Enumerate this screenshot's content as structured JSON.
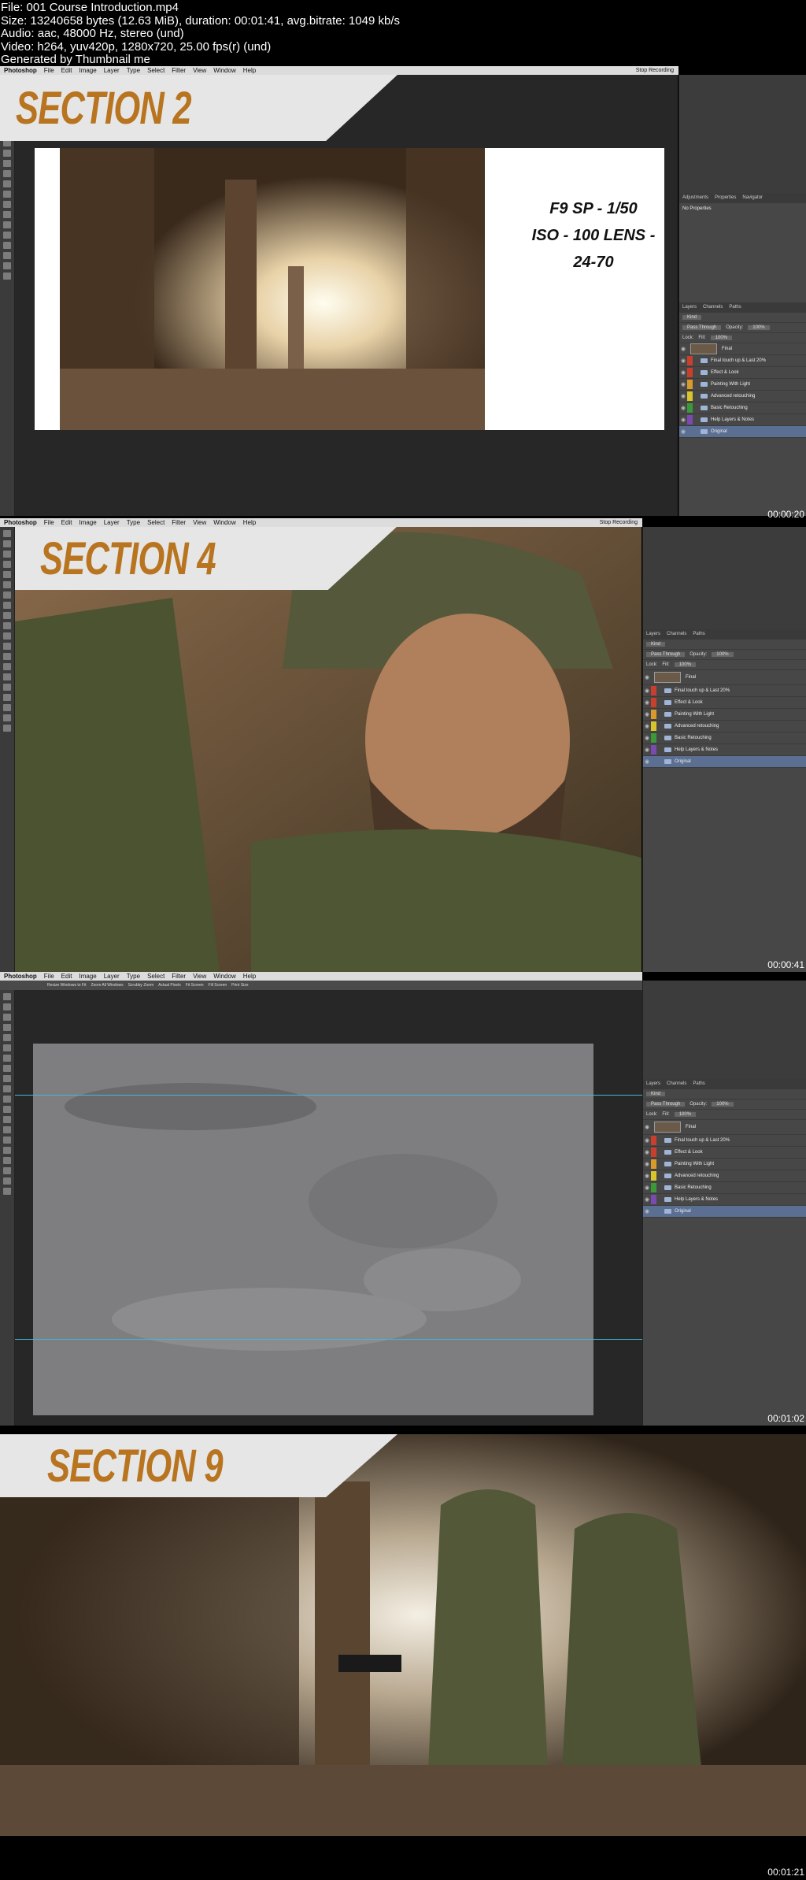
{
  "header": {
    "file": "File: 001 Course Introduction.mp4",
    "size": "Size: 13240658 bytes (12.63 MiB), duration: 00:01:41, avg.bitrate: 1049 kb/s",
    "audio": "Audio: aac, 48000 Hz, stereo (und)",
    "video": "Video: h264, yuv420p, 1280x720, 25.00 fps(r) (und)",
    "generated": "Generated by Thumbnail me"
  },
  "menu": {
    "app": "Photoshop",
    "items": [
      "File",
      "Edit",
      "Image",
      "Layer",
      "Type",
      "Select",
      "Filter",
      "View",
      "Window",
      "Help"
    ],
    "stop": "Stop Recording"
  },
  "frame1": {
    "section": "SECTION 2",
    "camera_line1": "F9  SP - 1/50",
    "camera_line2": "ISO - 100  LENS - 24-70",
    "timestamp": "00:00:20",
    "panel_tabs": [
      "Adjustments",
      "Properties",
      "Navigator"
    ],
    "no_properties": "No Properties"
  },
  "layers": {
    "tabs": [
      "Layers",
      "Channels",
      "Paths"
    ],
    "kind": "Kind",
    "blend": "Pass Through",
    "opacity_label": "Opacity:",
    "opacity": "100%",
    "lock_label": "Lock:",
    "fill_label": "Fill:",
    "fill": "100%",
    "items": [
      {
        "name": "Final",
        "swatch": ""
      },
      {
        "name": "Final touch up & Last 20%",
        "swatch": "#c8402d"
      },
      {
        "name": "Effect & Look",
        "swatch": "#c8402d"
      },
      {
        "name": "Painting With Light",
        "swatch": "#d99a2b"
      },
      {
        "name": "Advanced retouching",
        "swatch": "#d9c42b"
      },
      {
        "name": "Basic Retouching",
        "swatch": "#3a9a3a"
      },
      {
        "name": "Help Layers & Notes",
        "swatch": "#7a4ab0"
      },
      {
        "name": "Original",
        "swatch": ""
      }
    ]
  },
  "frame2": {
    "section": "SECTION 4",
    "timestamp": "00:00:41"
  },
  "frame3": {
    "timestamp": "00:01:02",
    "options": [
      "Resize Windows to Fit",
      "Zoom All Windows",
      "Scrubby Zoom",
      "Actual Pixels",
      "Fit Screen",
      "Fill Screen",
      "Print Size"
    ]
  },
  "frame4": {
    "section": "SECTION 9",
    "timestamp": "00:01:21"
  }
}
